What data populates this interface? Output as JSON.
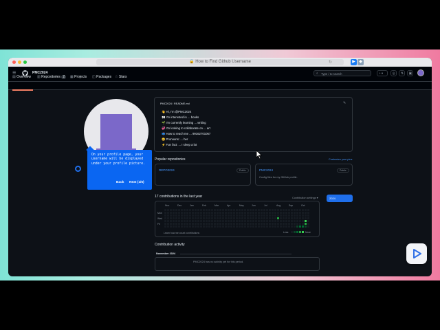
{
  "browser": {
    "url_title": "How to Find Github Username"
  },
  "header": {
    "username": "PMC2024",
    "search_placeholder": "Type / to search",
    "plus_label": "+ ▾"
  },
  "tabs": [
    {
      "label": "Overview"
    },
    {
      "label": "Repositories",
      "count": "2"
    },
    {
      "label": "Projects"
    },
    {
      "label": "Packages"
    },
    {
      "label": "Stars"
    }
  ],
  "readme": {
    "title": "PMC2024 / README.md",
    "items": [
      "👋 Hi, I'm @PMC2024",
      "👀 I'm interested in ... books",
      "🌱 I'm currently learning ... writing",
      "💞️ I'm looking to collaborate on ... art",
      "📫 How to reach me ... 99162701067",
      "😄 Pronouns: ... her",
      "⚡ Fun fact: ... I sleep a lot"
    ]
  },
  "popular": {
    "heading": "Popular repositories",
    "customize": "Customize your pins",
    "repos": [
      {
        "name": "REPO2024",
        "badge": "Public",
        "desc": ""
      },
      {
        "name": "PMC2024",
        "badge": "Public",
        "desc": "Config files for my GitHub profile."
      }
    ]
  },
  "contributions": {
    "heading": "17 contributions in the last year",
    "settings": "Contribution settings ▾",
    "year": "2024",
    "months": [
      "Nov",
      "Dec",
      "Jan",
      "Feb",
      "Mar",
      "Apr",
      "May",
      "Jun",
      "Jul",
      "Aug",
      "Sep",
      "Oct"
    ],
    "days": [
      "Mon",
      "Wed",
      "Fri"
    ],
    "learn": "Learn how we count contributions",
    "less": "Less",
    "more": "More"
  },
  "activity": {
    "heading": "Contribution activity",
    "month": "November 2024",
    "empty": "PMC2024 has no activity yet for this period."
  },
  "tooltip": {
    "text": "On your profile page, your username will be displayed under your profile picture.",
    "back": "Back",
    "next": "Next (1/5)"
  },
  "colors": {
    "accent": "#0a66f2",
    "gh_bg": "#0d1117",
    "link": "#4493f8",
    "green": "#39d353"
  }
}
